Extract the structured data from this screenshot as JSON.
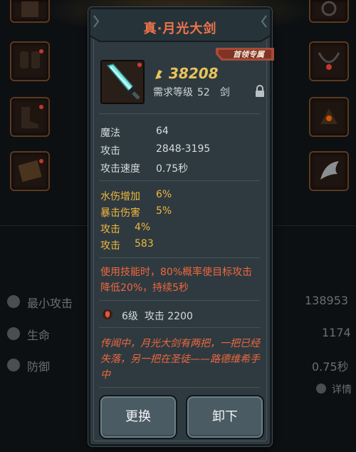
{
  "background": {
    "stats": [
      {
        "label": "最小攻击",
        "value": "138953",
        "icon": "sword-icon"
      },
      {
        "label": "生命",
        "value": "1174",
        "icon": "heart-icon"
      },
      {
        "label": "防御",
        "value": "0.75秒",
        "icon": "shield-icon"
      }
    ],
    "detail_label": "详情"
  },
  "item": {
    "title": "真·月光大剑",
    "badge": "首领专属",
    "icon": "greatsword-icon",
    "price": "38208",
    "price_icon": "coin-icon",
    "req_label": "需求等级",
    "req_level": "52",
    "type": "剑",
    "lock_icon": "lock-icon"
  },
  "base_attrs": [
    {
      "label": "魔法",
      "value": "64"
    },
    {
      "label": "攻击",
      "value": "2848-3195"
    },
    {
      "label": "攻击速度",
      "value": "0.75秒"
    }
  ],
  "bonus_attrs": [
    {
      "label": "水伤增加",
      "value": "6%"
    },
    {
      "label": "暴击伤害",
      "value": "5%"
    },
    {
      "label": "攻击",
      "value": "4%"
    },
    {
      "label": "攻击",
      "value": "583"
    }
  ],
  "skill_text": "使用技能时，80%概率使目标攻击降低20%，持续5秒",
  "gem": {
    "level": "6级",
    "attr": "攻击 2200",
    "icon": "gem-icon"
  },
  "lore": "传闻中，月光大剑有两把，一把已经失落，另一把在圣徒——路德维希手中",
  "buttons": {
    "replace": "更换",
    "unequip": "卸下"
  },
  "colors": {
    "title": "#f1734a",
    "price": "#e8c45a",
    "bonus": "#f2b73b",
    "skill": "#f0673e",
    "panel": "#2e3a40"
  }
}
